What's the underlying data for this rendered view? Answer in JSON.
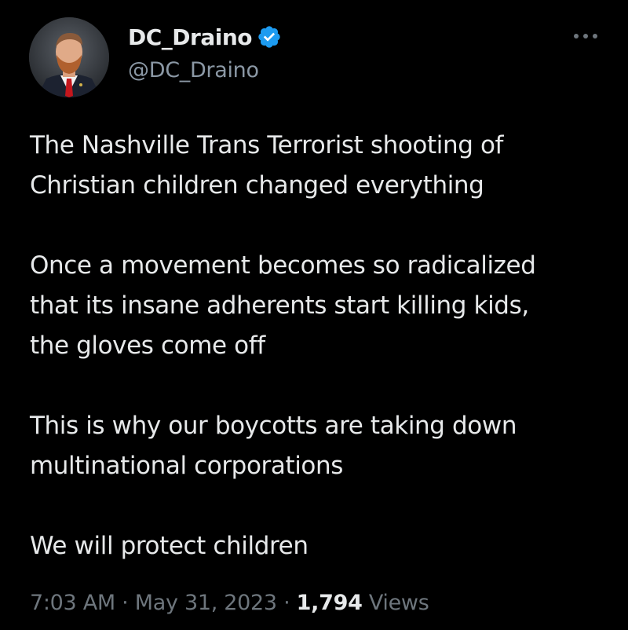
{
  "colors": {
    "background": "#000000",
    "primary_text": "#e7e9ea",
    "secondary_text": "#6e767d",
    "verified_badge": "#1d9bf0"
  },
  "author": {
    "display_name": "DC_Draino",
    "handle": "@DC_Draino",
    "verified": true,
    "avatar_icon": "profile-photo"
  },
  "menu": {
    "icon": "more-options-icon"
  },
  "tweet": {
    "paragraphs": [
      "The Nashville Trans Terrorist shooting of\nChristian children changed everything",
      "Once a movement becomes so radicalized\nthat its insane adherents start killing kids,\nthe gloves come off",
      "This is why our boycotts are taking down\nmultinational corporations",
      "We will protect children"
    ]
  },
  "meta": {
    "time": "7:03 AM",
    "separator": " · ",
    "date": "May 31, 2023",
    "views_count": "1,794",
    "views_label": " Views"
  }
}
